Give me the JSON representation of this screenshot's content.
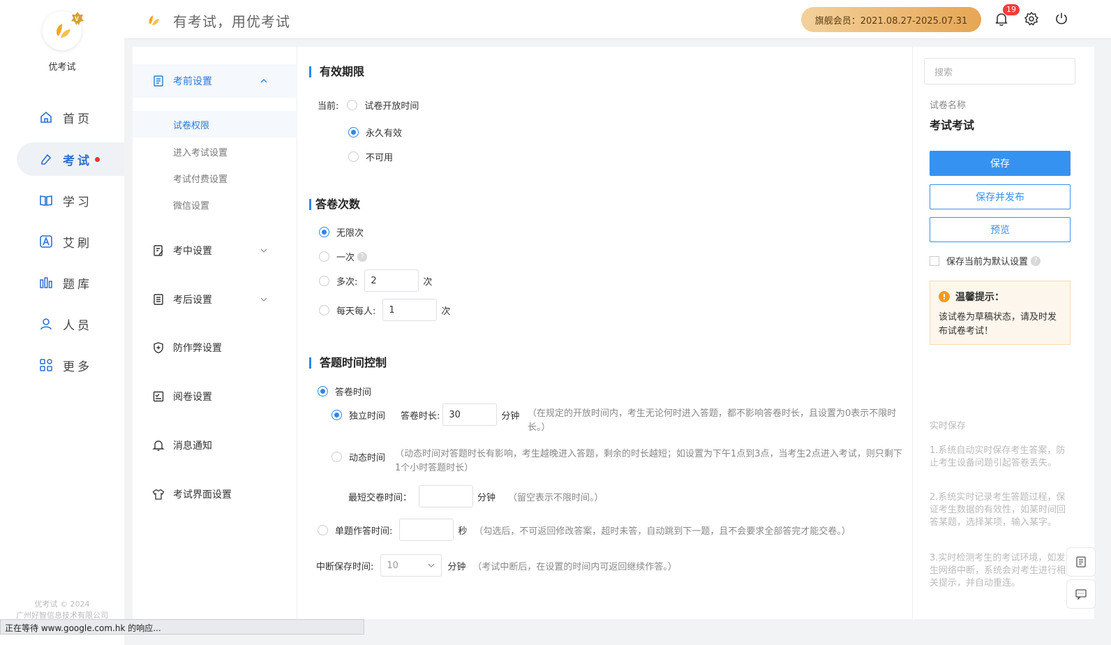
{
  "app": {
    "name": "优考试",
    "slogan": "有考试，用优考试"
  },
  "nav": {
    "items": [
      {
        "label": "首页",
        "icon": "home-icon"
      },
      {
        "label": "考试",
        "icon": "exam-icon",
        "active": true,
        "has_dot": true
      },
      {
        "label": "学习",
        "icon": "book-icon"
      },
      {
        "label": "艾刷",
        "icon": "a-letter-icon"
      },
      {
        "label": "题库",
        "icon": "bar-chart-icon"
      },
      {
        "label": "人员",
        "icon": "user-icon"
      },
      {
        "label": "更多",
        "icon": "grid-icon"
      }
    ],
    "footer_line1": "优考试 © 2024",
    "footer_line2": "广州好智信息技术有限公司"
  },
  "topbar": {
    "member": "旗舰会员：2021.08.27-2025.07.31",
    "notif_count": "19"
  },
  "subnav": {
    "before": {
      "label": "考前设置",
      "icon": "document-icon"
    },
    "before_children": [
      "试卷权限",
      "进入考试设置",
      "考试付费设置",
      "微信设置"
    ],
    "during": {
      "label": "考中设置",
      "icon": "edit-doc-icon"
    },
    "after": {
      "label": "考后设置",
      "icon": "score-doc-icon"
    },
    "anticheat": {
      "label": "防作弊设置",
      "icon": "shield-icon"
    },
    "marking": {
      "label": "阅卷设置",
      "icon": "checklist-icon"
    },
    "notify": {
      "label": "消息通知",
      "icon": "bell-icon"
    },
    "ui": {
      "label": "考试界面设置",
      "icon": "shirt-icon"
    }
  },
  "validity": {
    "title": "有效期限",
    "current_label": "当前:",
    "options": [
      "试卷开放时间",
      "永久有效",
      "不可用"
    ],
    "selected": 1
  },
  "attempts": {
    "title": "答卷次数",
    "unlimited": "无限次",
    "once": "一次",
    "multi": "多次:",
    "multi_value": "2",
    "daily": "每天每人:",
    "daily_value": "1",
    "unit": "次"
  },
  "timing": {
    "title": "答题时间控制",
    "exam_time": "答卷时间",
    "independent": "独立时间",
    "duration_label": "答卷时长:",
    "duration_value": "30",
    "minutes": "分钟",
    "independent_note": "（在规定的开放时间内，考生无论何时进入答题，都不影响答卷时长，且设置为0表示不限时长。）",
    "dynamic": "动态时间",
    "dynamic_note": "（动态时间对答题时长有影响，考生越晚进入答题，剩余的时长越短；如设置为下午1点到3点，当考生2点进入考试，则只剩下1个小时答题时长）",
    "min_submit_label": "最短交卷时间：",
    "min_submit_note": "（留空表示不限时间。）",
    "single_label": "单题作答时间:",
    "seconds": "秒",
    "single_note": "（勾选后，不可返回修改答案，超时未答，自动跳到下一题，且不会要求全部答完才能交卷。）",
    "interrupt_label": "中断保存时间:",
    "interrupt_value": "10",
    "interrupt_note": "（考试中断后，在设置的时间内可返回继续作答。）"
  },
  "right": {
    "search_placeholder": "搜索",
    "paper_name_label": "试卷名称",
    "paper_name": "考试考试",
    "save": "保存",
    "save_publish": "保存并发布",
    "preview": "预览",
    "default_setting": "保存当前为默认设置",
    "tip_title": "温馨提示：",
    "tip_body": "该试卷为草稿状态，请及时发布试卷考试！",
    "realtime_title": "实时保存",
    "realtime_items": [
      "1.系统自动实时保存考生答案，防止考生设备问题引起答卷丢失。",
      "2.系统实时记录考生答题过程，保证考生数据的有效性，如某时间回答某题，选择某项，输入某字。",
      "3.实时检测考生的考试环境，如发生网络中断，系统会对考生进行相关提示，并自动重连。"
    ]
  },
  "statusbar": "正在等待 www.google.com.hk 的响应...",
  "colors": {
    "accent": "#2a86ee",
    "primary_button": "#3592f0",
    "badge_red": "#f23c3c",
    "member_gold": "#e6a654"
  }
}
